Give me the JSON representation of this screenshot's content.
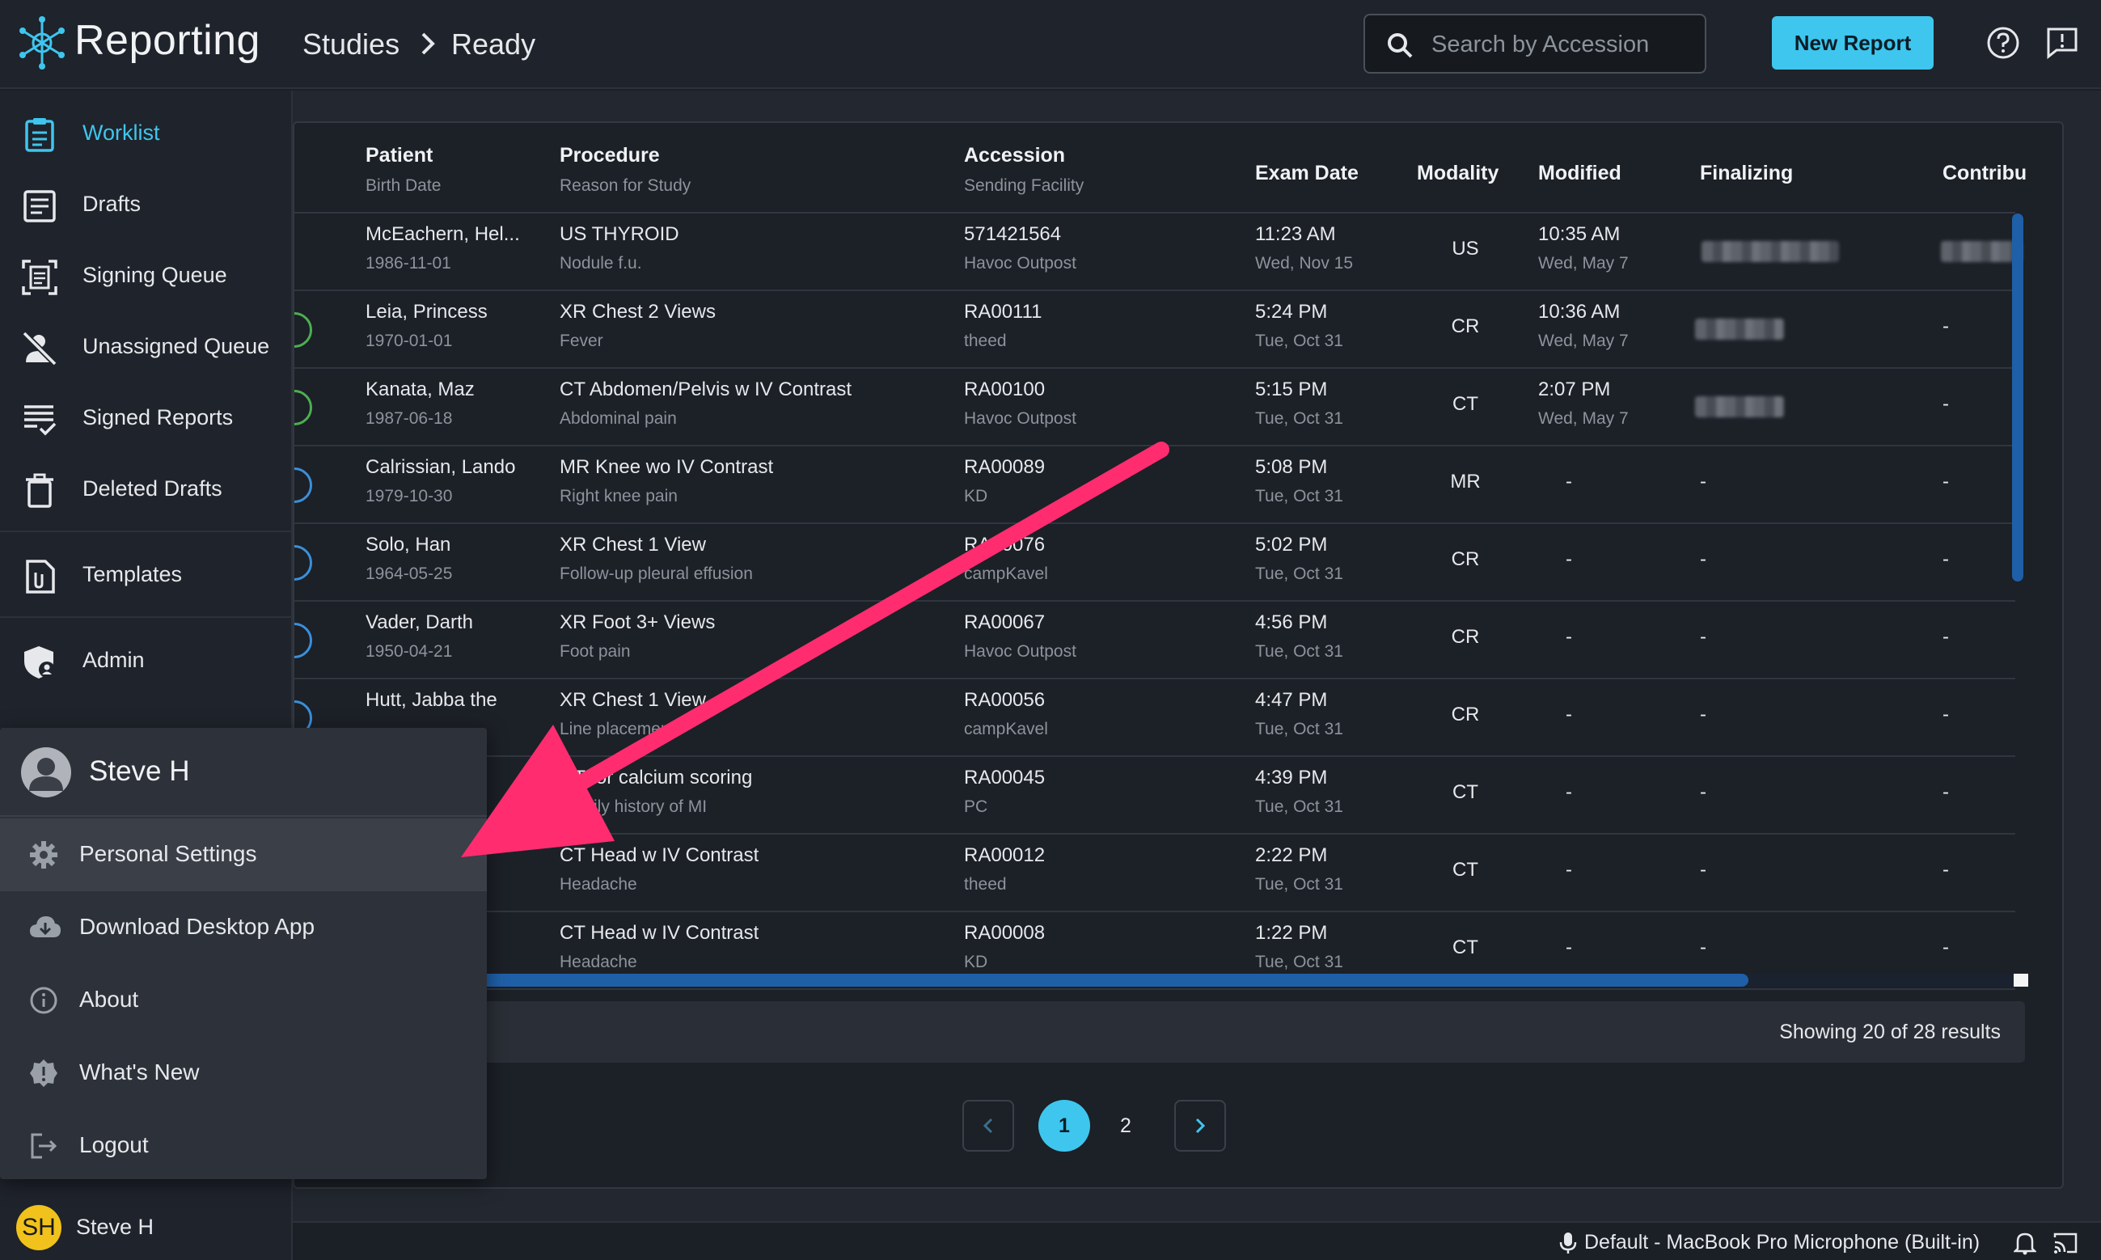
{
  "header": {
    "app_title": "Reporting",
    "breadcrumb": [
      "Studies",
      "Ready"
    ],
    "search_placeholder": "Search by Accession",
    "new_report_label": "New Report",
    "accent": "#3ec6ee"
  },
  "sidebar": {
    "items": [
      {
        "label": "Worklist",
        "icon": "clipboard-icon",
        "active": true
      },
      {
        "label": "Drafts",
        "icon": "document-icon"
      },
      {
        "label": "Signing Queue",
        "icon": "scan-document-icon"
      },
      {
        "label": "Unassigned Queue",
        "icon": "user-slash-icon"
      },
      {
        "label": "Signed Reports",
        "icon": "checklist-icon"
      },
      {
        "label": "Deleted Drafts",
        "icon": "trash-icon"
      },
      {
        "label": "Templates",
        "icon": "template-icon"
      },
      {
        "label": "Admin",
        "icon": "shield-user-icon"
      }
    ],
    "user_initials": "SH",
    "user_name": "Steve H"
  },
  "table": {
    "columns": [
      {
        "title": "Patient",
        "sub": "Birth Date"
      },
      {
        "title": "Procedure",
        "sub": "Reason for Study"
      },
      {
        "title": "Accession",
        "sub": "Sending Facility"
      },
      {
        "title": "Exam Date"
      },
      {
        "title": "Modality"
      },
      {
        "title": "Modified"
      },
      {
        "title": "Finalizing"
      },
      {
        "title": "Contribu"
      }
    ],
    "rows": [
      {
        "patient": "McEachern, Hel...",
        "birth": "1986-11-01",
        "procedure": "US THYROID",
        "reason": "Nodule f.u.",
        "accession": "571421564",
        "facility": "Havoc Outpost",
        "exam_time": "11:23 AM",
        "exam_date": "Wed, Nov 15",
        "modality": "US",
        "mod_time": "10:35 AM",
        "mod_date": "Wed, May 7",
        "finalizing": "",
        "contrib": ""
      },
      {
        "patient": "Leia, Princess",
        "birth": "1970-01-01",
        "procedure": "XR Chest 2 Views",
        "reason": "Fever",
        "accession": "RA00111",
        "facility": "theed",
        "exam_time": "5:24 PM",
        "exam_date": "Tue, Oct 31",
        "modality": "CR",
        "mod_time": "10:36 AM",
        "mod_date": "Wed, May 7",
        "finalizing": "",
        "contrib": "-"
      },
      {
        "patient": "Kanata, Maz",
        "birth": "1987-06-18",
        "procedure": "CT Abdomen/Pelvis w IV Contrast",
        "reason": "Abdominal pain",
        "accession": "RA00100",
        "facility": "Havoc Outpost",
        "exam_time": "5:15 PM",
        "exam_date": "Tue, Oct 31",
        "modality": "CT",
        "mod_time": "2:07 PM",
        "mod_date": "Wed, May 7",
        "finalizing": "",
        "contrib": "-"
      },
      {
        "patient": "Calrissian, Lando",
        "birth": "1979-10-30",
        "procedure": "MR Knee wo IV Contrast",
        "reason": "Right knee pain",
        "accession": "RA00089",
        "facility": "KD",
        "exam_time": "5:08 PM",
        "exam_date": "Tue, Oct 31",
        "modality": "MR",
        "mod_time": "-",
        "mod_date": "",
        "finalizing": "-",
        "contrib": "-"
      },
      {
        "patient": "Solo, Han",
        "birth": "1964-05-25",
        "procedure": "XR Chest 1 View",
        "reason": "Follow-up pleural effusion",
        "accession": "RA00076",
        "facility": "campKavel",
        "exam_time": "5:02 PM",
        "exam_date": "Tue, Oct 31",
        "modality": "CR",
        "mod_time": "-",
        "mod_date": "",
        "finalizing": "-",
        "contrib": "-"
      },
      {
        "patient": "Vader, Darth",
        "birth": "1950-04-21",
        "procedure": "XR Foot 3+ Views",
        "reason": "Foot pain",
        "accession": "RA00067",
        "facility": "Havoc Outpost",
        "exam_time": "4:56 PM",
        "exam_date": "Tue, Oct 31",
        "modality": "CR",
        "mod_time": "-",
        "mod_date": "",
        "finalizing": "-",
        "contrib": "-"
      },
      {
        "patient": "Hutt, Jabba the",
        "birth": "",
        "procedure": "XR Chest 1 View",
        "reason": "Line placement",
        "accession": "RA00056",
        "facility": "campKavel",
        "exam_time": "4:47 PM",
        "exam_date": "Tue, Oct 31",
        "modality": "CR",
        "mod_time": "-",
        "mod_date": "",
        "finalizing": "-",
        "contrib": "-"
      },
      {
        "patient": "",
        "birth": "",
        "procedure": "CT for calcium scoring",
        "reason": "Family history of MI",
        "accession": "RA00045",
        "facility": "PC",
        "exam_time": "4:39 PM",
        "exam_date": "Tue, Oct 31",
        "modality": "CT",
        "mod_time": "-",
        "mod_date": "",
        "finalizing": "-",
        "contrib": "-"
      },
      {
        "patient": "",
        "birth": "",
        "procedure": "CT Head w IV Contrast",
        "reason": "Headache",
        "accession": "RA00012",
        "facility": "theed",
        "exam_time": "2:22 PM",
        "exam_date": "Tue, Oct 31",
        "modality": "CT",
        "mod_time": "-",
        "mod_date": "",
        "finalizing": "-",
        "contrib": "-"
      },
      {
        "patient": "",
        "birth": "",
        "procedure": "CT Head w IV Contrast",
        "reason": "Headache",
        "accession": "RA00008",
        "facility": "KD",
        "exam_time": "1:22 PM",
        "exam_date": "Tue, Oct 31",
        "modality": "CT",
        "mod_time": "-",
        "mod_date": "",
        "finalizing": "-",
        "contrib": "-"
      }
    ],
    "results_label": "Showing 20 of 28 results"
  },
  "pagination": {
    "pages": [
      "1",
      "2"
    ],
    "current": "1"
  },
  "user_menu": {
    "name": "Steve H",
    "items": [
      {
        "label": "Personal Settings",
        "icon": "gear-icon",
        "highlighted": true
      },
      {
        "label": "Download Desktop App",
        "icon": "cloud-download-icon"
      },
      {
        "label": "About",
        "icon": "info-icon"
      },
      {
        "label": "What's New",
        "icon": "badge-alert-icon"
      },
      {
        "label": "Logout",
        "icon": "logout-icon"
      }
    ]
  },
  "statusbar": {
    "mic_label": "Default - MacBook Pro Microphone (Built-in)"
  },
  "annotation_color": "#ff2d6f"
}
